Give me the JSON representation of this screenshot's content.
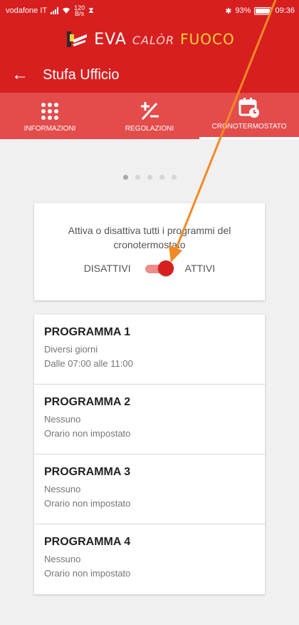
{
  "statusbar": {
    "carrier": "vodafone IT",
    "speed_value": "120",
    "speed_unit": "B/s",
    "battery": "93%",
    "time": "09:36"
  },
  "brand": {
    "name": "EVA",
    "calor": "CALÒR",
    "fuoco": "FUOCO"
  },
  "appbar": {
    "title": "Stufa Ufficio"
  },
  "tabs": [
    {
      "label": "INFORMAZIONI",
      "icon": "grid-icon"
    },
    {
      "label": "REGOLAZIONI",
      "icon": "plus-minus-icon"
    },
    {
      "label": "CRONOTERMOSTATO",
      "icon": "calendar-clock-icon"
    }
  ],
  "pager": {
    "count": 5,
    "active": 0
  },
  "toggle_card": {
    "description": "Attiva o disattiva tutti i programmi del cronotermostato",
    "off_label": "DISATTIVI",
    "on_label": "ATTIVI",
    "state": "on"
  },
  "programs": [
    {
      "name": "PROGRAMMA 1",
      "days": "Diversi giorni",
      "time": "Dalle 07:00 alle 11:00"
    },
    {
      "name": "PROGRAMMA 2",
      "days": "Nessuno",
      "time": "Orario non impostato"
    },
    {
      "name": "PROGRAMMA 3",
      "days": "Nessuno",
      "time": "Orario non impostato"
    },
    {
      "name": "PROGRAMMA 4",
      "days": "Nessuno",
      "time": "Orario non impostato"
    }
  ],
  "colors": {
    "primary": "#d71f1f",
    "tabbar": "#e44b4b",
    "annotation_arrow": "#f08a24"
  }
}
